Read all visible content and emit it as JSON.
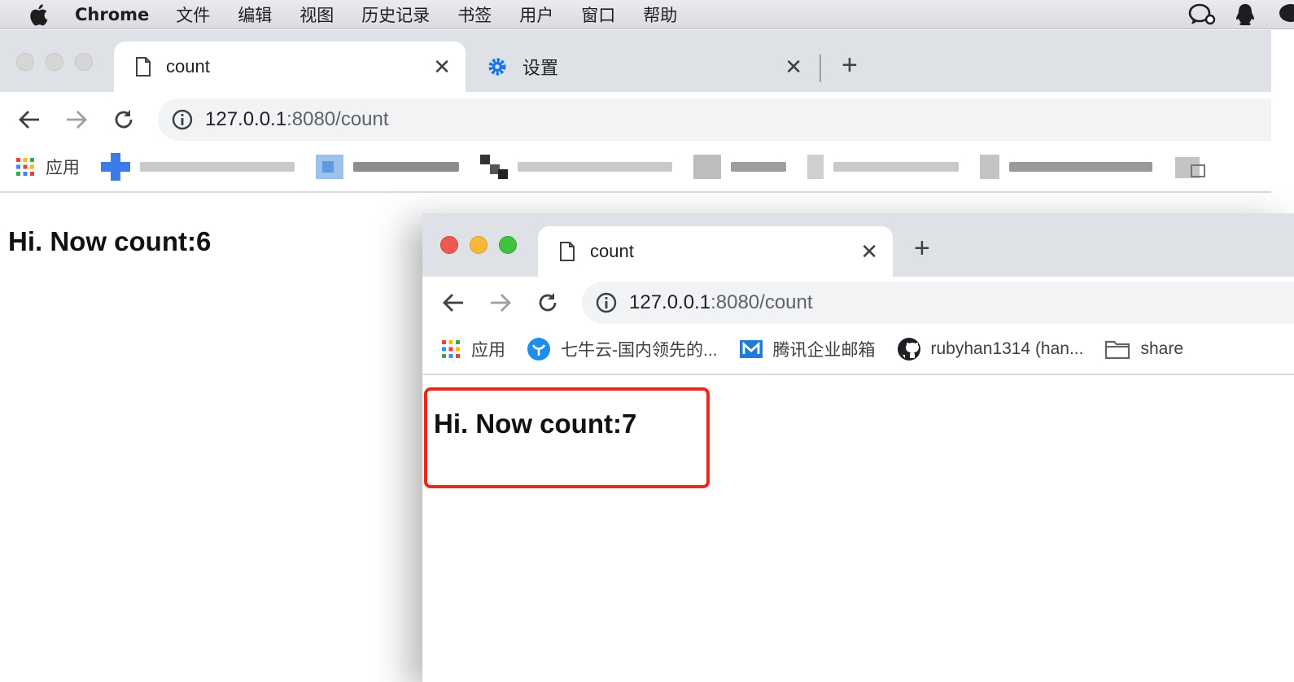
{
  "menubar": {
    "app": "Chrome",
    "items": [
      "文件",
      "编辑",
      "视图",
      "历史记录",
      "书签",
      "用户",
      "窗口",
      "帮助"
    ]
  },
  "back_window": {
    "tabs": [
      {
        "title": "count",
        "icon": "page-icon",
        "active": true
      },
      {
        "title": "设置",
        "icon": "settings-gear-icon",
        "active": false
      }
    ],
    "url_host": "127.0.0.1",
    "url_path": ":8080/count",
    "bookmarks_apps_label": "应用",
    "page_text": "Hi. Now count:6"
  },
  "front_window": {
    "tabs": [
      {
        "title": "count",
        "icon": "page-icon",
        "active": true
      }
    ],
    "url_host": "127.0.0.1",
    "url_path": ":8080/count",
    "bookmarks": [
      {
        "label": "应用",
        "icon": "apps-grid-icon"
      },
      {
        "label": "七牛云-国内领先的...",
        "icon": "qiniu-icon"
      },
      {
        "label": "腾讯企业邮箱",
        "icon": "tencent-mail-icon"
      },
      {
        "label": "rubyhan1314 (han...",
        "icon": "github-icon"
      },
      {
        "label": "share",
        "icon": "folder-icon"
      }
    ],
    "page_text": "Hi. Now count:7"
  },
  "colors": {
    "highlight": "#e8291c",
    "tabstrip": "#dee1e6",
    "close_red": "#ee5a52",
    "minimize_yellow": "#f5b83a",
    "zoom_green": "#3fc33f"
  }
}
